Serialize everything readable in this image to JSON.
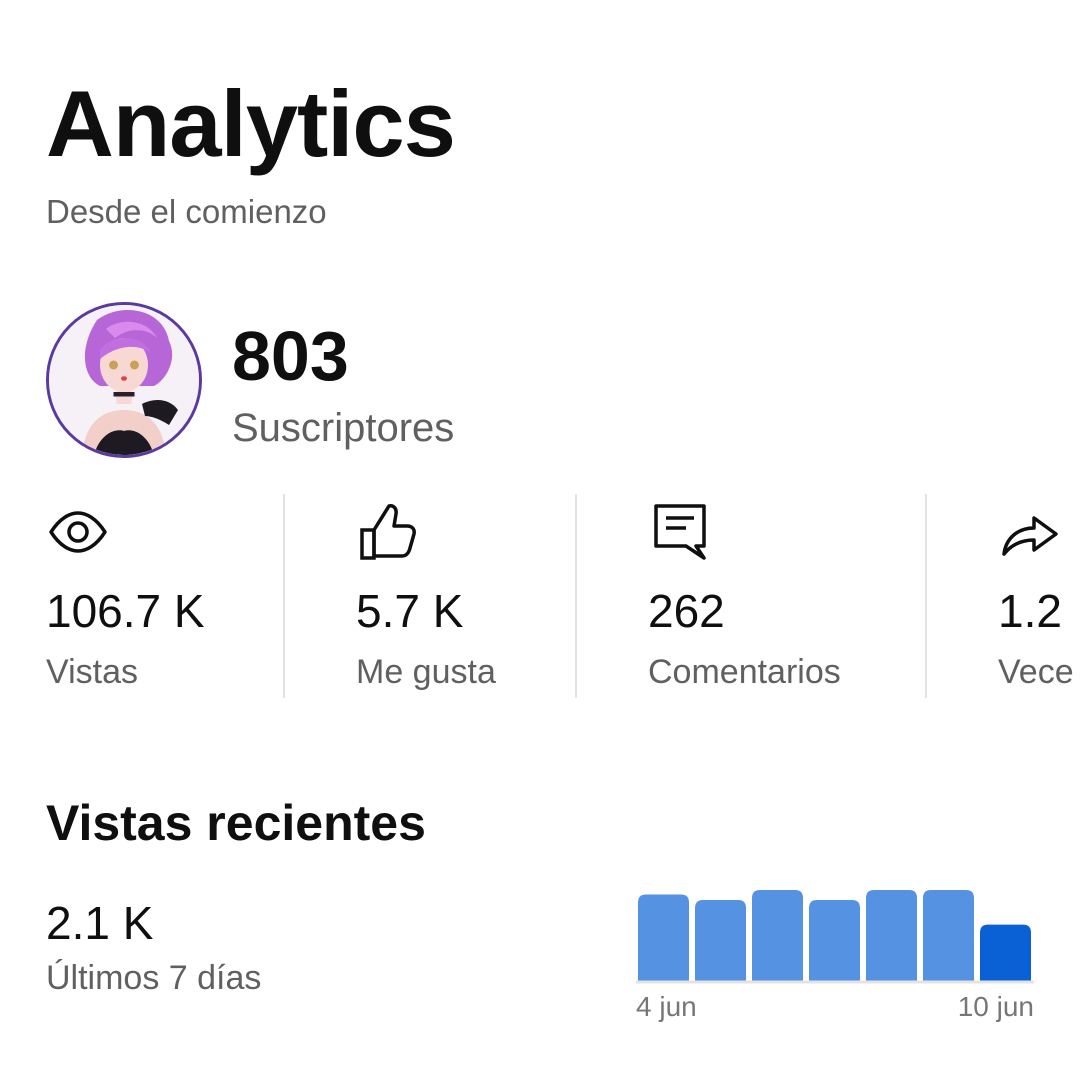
{
  "header": {
    "title": "Analytics",
    "subtitle": "Desde el comienzo"
  },
  "channel": {
    "subscribers_value": "803",
    "subscribers_label": "Suscriptores"
  },
  "stats": [
    {
      "icon": "eye-icon",
      "value": "106.7 K",
      "label": "Vistas"
    },
    {
      "icon": "thumbs-up-icon",
      "value": "5.7 K",
      "label": "Me gusta"
    },
    {
      "icon": "comment-icon",
      "value": "262",
      "label": "Comentarios"
    },
    {
      "icon": "share-icon",
      "value": "1.2",
      "label": "Vece"
    }
  ],
  "recent": {
    "title": "Vistas recientes",
    "value": "2.1 K",
    "label": "Últimos 7 días"
  },
  "chart_data": {
    "type": "bar",
    "x_tick_labels": [
      "4 jun",
      "10 jun"
    ],
    "values": [
      0.95,
      0.89,
      1.0,
      0.89,
      1.0,
      1.0,
      0.62
    ],
    "value_note": "relative heights (no y axis shown)",
    "colors": {
      "bar": "#5592e1",
      "highlight": "#0a61d6",
      "baseline": "#e3e3e3"
    },
    "highlight_index": 6
  }
}
